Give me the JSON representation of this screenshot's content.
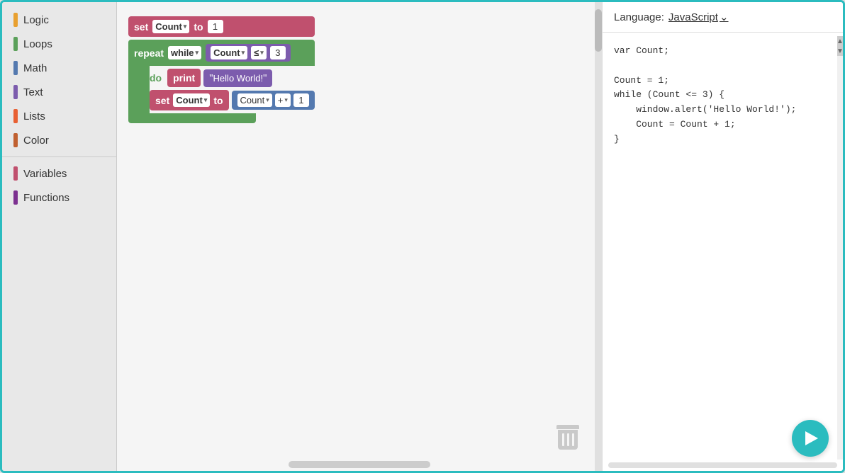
{
  "sidebar": {
    "items": [
      {
        "id": "logic",
        "label": "Logic",
        "color": "#e8a030"
      },
      {
        "id": "loops",
        "label": "Loops",
        "color": "#5ba05a"
      },
      {
        "id": "math",
        "label": "Math",
        "color": "#5479af"
      },
      {
        "id": "text",
        "label": "Text",
        "color": "#7c5cad"
      },
      {
        "id": "lists",
        "label": "Lists",
        "color": "#e86033"
      },
      {
        "id": "color",
        "label": "Color",
        "color": "#c06030"
      },
      {
        "id": "variables",
        "label": "Variables",
        "color": "#c0506e"
      },
      {
        "id": "functions",
        "label": "Functions",
        "color": "#7c3090"
      }
    ]
  },
  "code_panel": {
    "language_label": "Language:",
    "language": "JavaScript",
    "code": "var Count;\n\nCount = 1;\nwhile (Count <= 3) {\n    window.alert('Hello World!');\n    Count = Count + 1;\n}"
  },
  "blocks": {
    "row1": {
      "set_label": "set",
      "var_name": "Count",
      "to_label": "to",
      "value": "1"
    },
    "repeat": {
      "repeat_label": "repeat",
      "while_label": "while",
      "var_name": "Count",
      "operator": "≤",
      "value": "3"
    },
    "do_print": {
      "do_label": "do",
      "print_label": "print",
      "string": "Hello World!"
    },
    "set_count": {
      "set_label": "set",
      "var_name": "Count",
      "to_label": "to",
      "count_var": "Count",
      "plus": "+",
      "value": "1"
    }
  },
  "run_button": {
    "label": "Run"
  }
}
